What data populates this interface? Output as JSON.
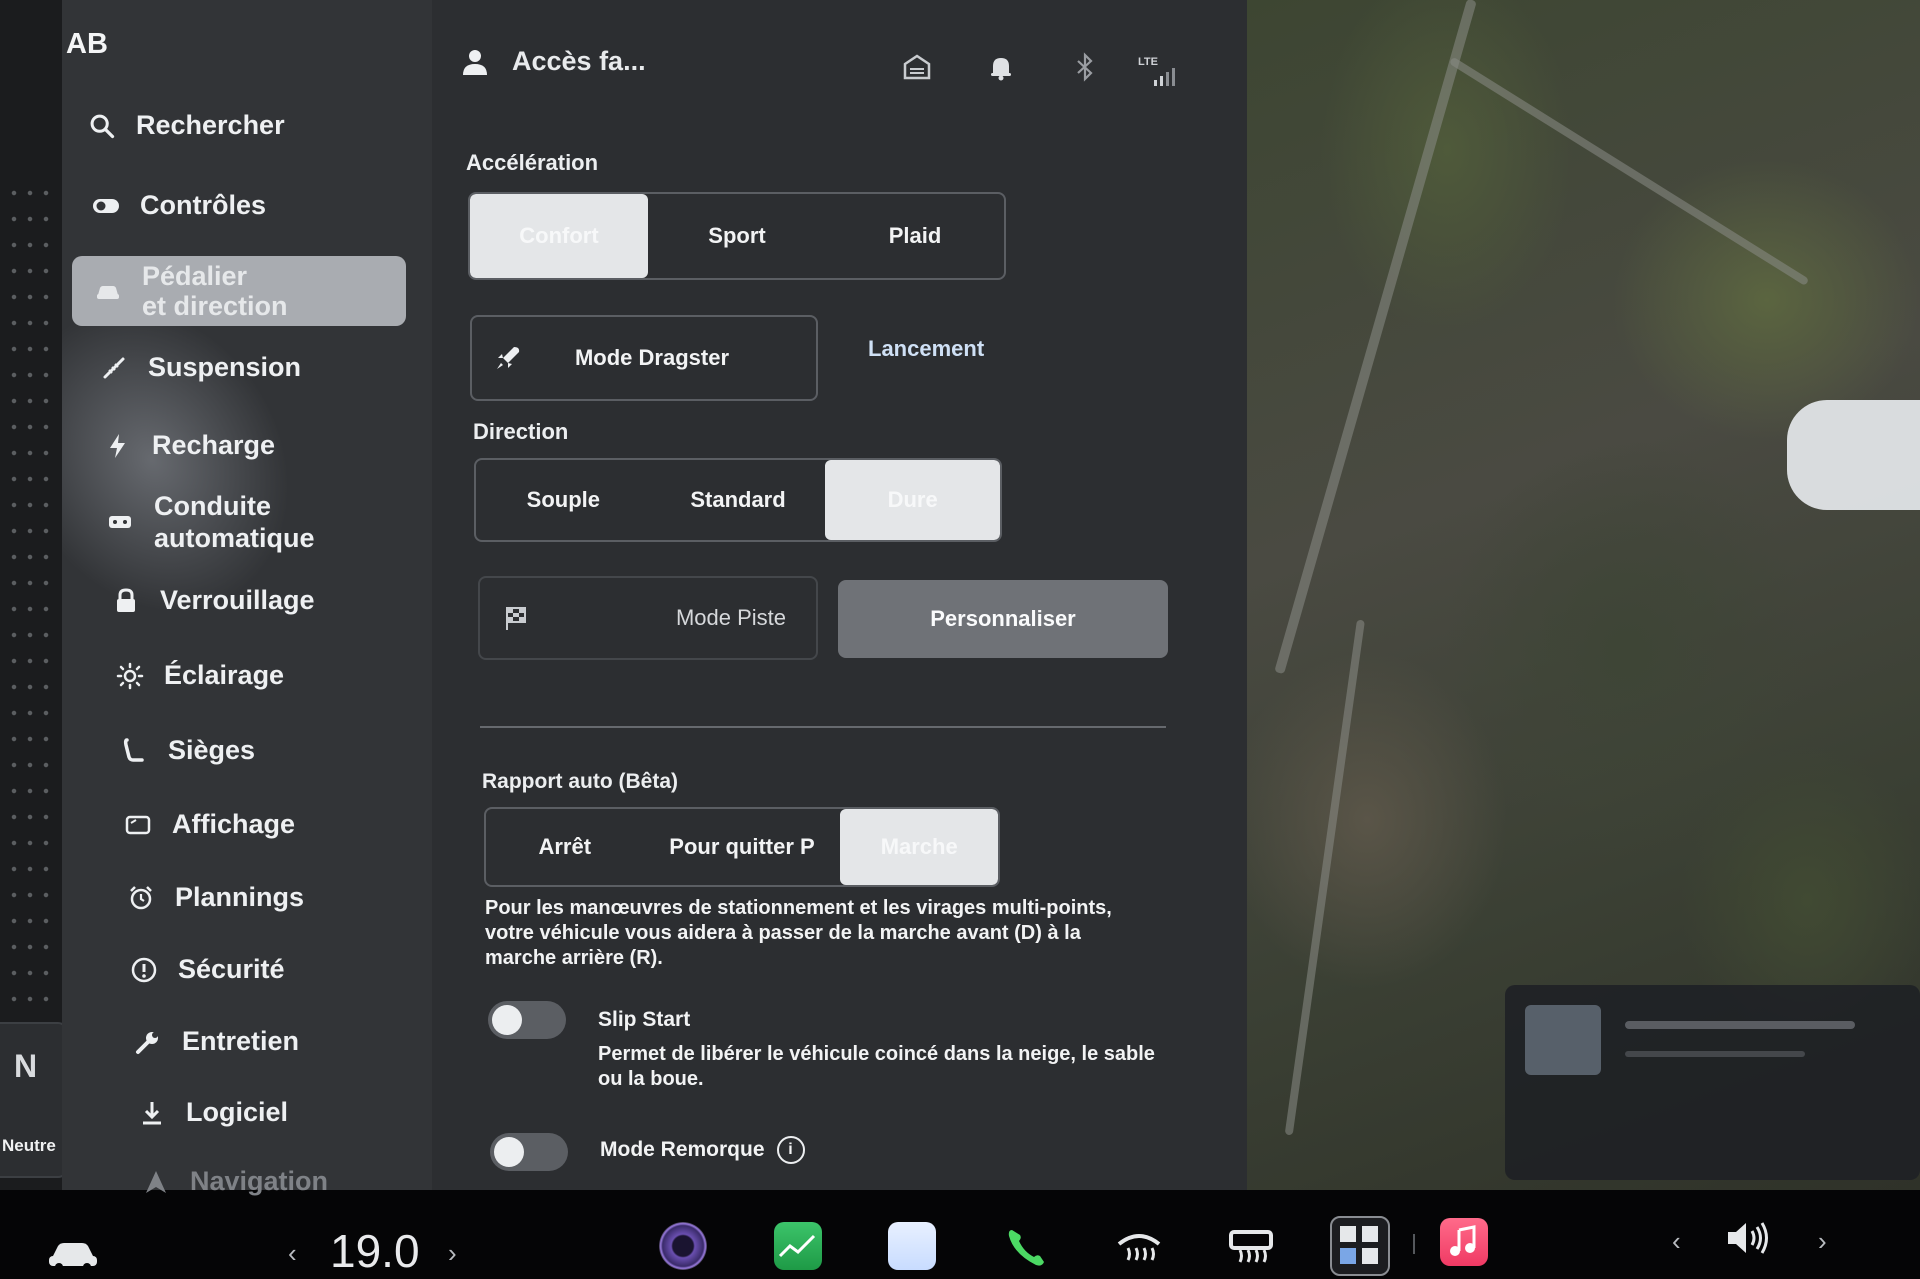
{
  "user": {
    "initials": "AB",
    "profile_name": "Accès fa..."
  },
  "nav": {
    "items": [
      {
        "label": "Rechercher",
        "icon": "search-icon"
      },
      {
        "label": "Contrôles",
        "icon": "toggle-icon"
      },
      {
        "label": "Pédalier et direction",
        "line1": "Pédalier",
        "line2": "et direction",
        "icon": "car-icon",
        "active": true
      },
      {
        "label": "Suspension",
        "icon": "suspension-icon"
      },
      {
        "label": "Recharge",
        "icon": "bolt-icon"
      },
      {
        "label": "Conduite automatique",
        "line1": "Conduite",
        "line2": "automatique",
        "icon": "steering-wheel-icon"
      },
      {
        "label": "Verrouillage",
        "icon": "lock-icon"
      },
      {
        "label": "Éclairage",
        "icon": "sun-icon"
      },
      {
        "label": "Sièges",
        "icon": "seat-icon"
      },
      {
        "label": "Affichage",
        "icon": "display-icon"
      },
      {
        "label": "Plannings",
        "icon": "alarm-clock-icon"
      },
      {
        "label": "Sécurité",
        "icon": "alert-circle-icon"
      },
      {
        "label": "Entretien",
        "icon": "wrench-icon"
      },
      {
        "label": "Logiciel",
        "icon": "download-icon"
      },
      {
        "label": "Navigation",
        "icon": "navigation-arrow-icon"
      }
    ]
  },
  "gear": {
    "letter": "N",
    "label": "Neutre"
  },
  "status": {
    "lte": "LTE",
    "icons": [
      "garage-icon",
      "bell-icon",
      "bluetooth-icon",
      "lte-signal-icon"
    ]
  },
  "acceleration": {
    "title": "Accélération",
    "options": [
      "Confort",
      "Sport",
      "Plaid"
    ],
    "selected": "Confort"
  },
  "dragster": {
    "label": "Mode Dragster",
    "link": "Lancement"
  },
  "direction": {
    "title": "Direction",
    "options": [
      "Souple",
      "Standard",
      "Dure"
    ],
    "selected": "Dure"
  },
  "track": {
    "label": "Mode Piste",
    "customize": "Personnaliser"
  },
  "auto_gear": {
    "title": "Rapport auto (Bêta)",
    "options": [
      "Arrêt",
      "Pour quitter P",
      "Marche"
    ],
    "selected": "Marche",
    "description": "Pour les manœuvres de stationnement et les virages multi-points, votre véhicule vous aidera à passer de la marche avant (D) à la marche arrière (R)."
  },
  "slip_start": {
    "title": "Slip Start",
    "description": "Permet de libérer le véhicule coincé dans la neige, le sable ou la boue.",
    "enabled": false
  },
  "trailer_mode": {
    "title": "Mode Remorque",
    "info": "i",
    "enabled": false
  },
  "bottom_bar": {
    "temperature": "19.0",
    "left_chevron": "‹",
    "right_chevron": "›",
    "volume_left": "‹",
    "volume_right": "›",
    "icons": [
      "car-icon",
      "camera-icon",
      "stocks-app-icon",
      "blank-app-icon",
      "phone-icon",
      "front-defrost-icon",
      "rear-defrost-icon",
      "apps-grid-icon",
      "music-app-icon",
      "volume-icon"
    ]
  }
}
